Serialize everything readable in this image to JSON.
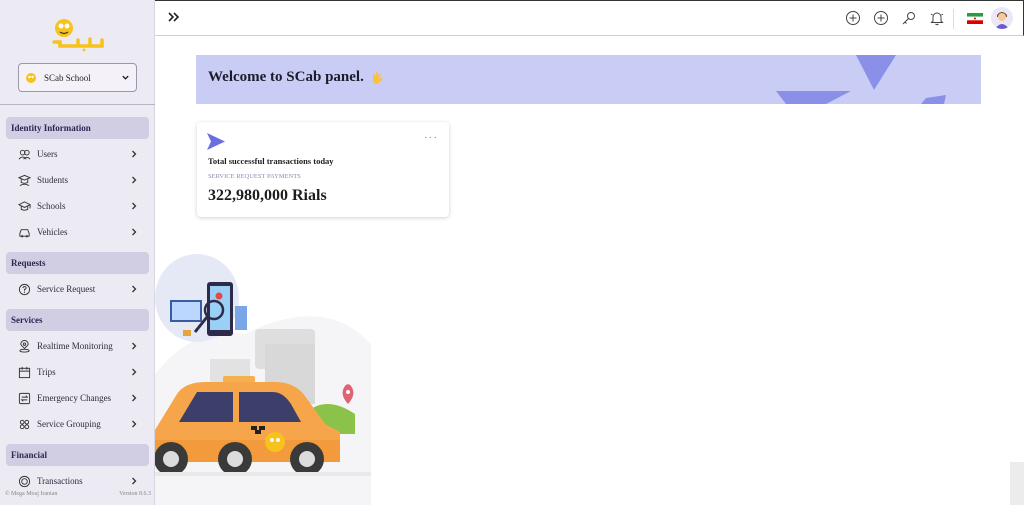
{
  "school": {
    "selected": "SCab School"
  },
  "sidebar": {
    "sections": [
      {
        "title": "Identity Information",
        "items": [
          {
            "label": "Users",
            "icon": "users-icon"
          },
          {
            "label": "Students",
            "icon": "student-icon"
          },
          {
            "label": "Schools",
            "icon": "graduation-cap-icon"
          },
          {
            "label": "Vehicles",
            "icon": "car-icon"
          }
        ]
      },
      {
        "title": "Requests",
        "items": [
          {
            "label": "Service Request",
            "icon": "question-circle-icon"
          }
        ]
      },
      {
        "title": "Services",
        "items": [
          {
            "label": "Realtime Monitoring",
            "icon": "location-pin-icon"
          },
          {
            "label": "Trips",
            "icon": "calendar-icon"
          },
          {
            "label": "Emergency Changes",
            "icon": "swap-icon"
          },
          {
            "label": "Service Grouping",
            "icon": "group-icon"
          }
        ]
      },
      {
        "title": "Financial",
        "items": [
          {
            "label": "Transactions",
            "icon": "coin-icon"
          }
        ]
      }
    ],
    "footer": {
      "copyright": "© Mega Moaj Iranian",
      "version": "Version 8.6.3"
    }
  },
  "topbar": {
    "icons": [
      "expand-icon",
      "add-circle-icon",
      "add-circle-icon",
      "key-icon",
      "bell-icon",
      "iran-flag-icon",
      "avatar"
    ]
  },
  "banner": {
    "title": "Welcome to SCab panel.",
    "emoji_icon": "waving-hand-icon"
  },
  "card": {
    "title": "Total successful transactions today",
    "subtitle": "SERVICE REQUEST PAYMENTS",
    "value": "322,980,000 Rials",
    "menu": "···"
  },
  "colors": {
    "sidebar_bg": "#eceaf3",
    "section_bg": "#d1cde3",
    "banner_bg": "#c9cdf6",
    "accent": "#6a6fe0",
    "taxi": "#f7a54a"
  }
}
